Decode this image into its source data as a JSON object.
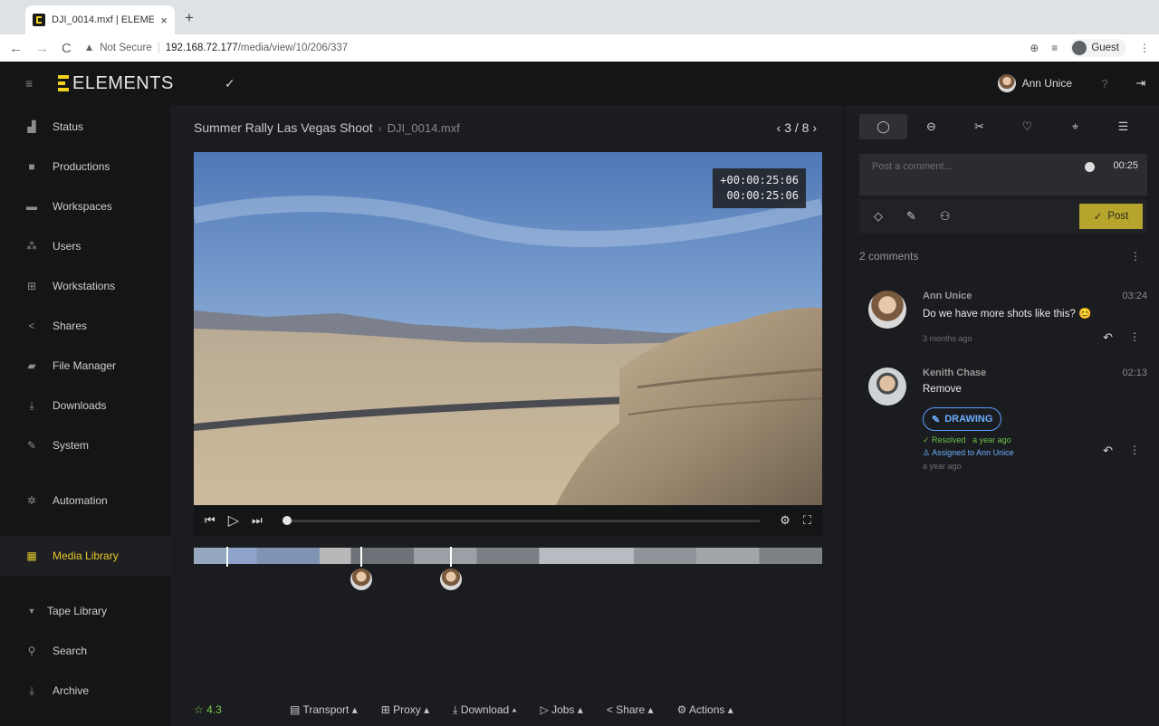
{
  "browser": {
    "tab_title": "DJI_0014.mxf | ELEMENTS",
    "url_security": "Not Secure",
    "url_host": "192.168.72.177",
    "url_path": "/media/view/10/206/337",
    "profile": "Guest"
  },
  "topbar": {
    "logo": "ELEMENTS",
    "user": "Ann Unice",
    "help": "?"
  },
  "sidebar": {
    "items": [
      {
        "label": "Status",
        "icon": "chart-icon"
      },
      {
        "label": "Productions",
        "icon": "briefcase-icon"
      },
      {
        "label": "Workspaces",
        "icon": "folder-icon"
      },
      {
        "label": "Users",
        "icon": "users-icon"
      },
      {
        "label": "Workstations",
        "icon": "network-icon"
      },
      {
        "label": "Shares",
        "icon": "share-icon"
      },
      {
        "label": "File Manager",
        "icon": "files-icon"
      },
      {
        "label": "Downloads",
        "icon": "download-icon"
      },
      {
        "label": "System",
        "icon": "wrench-icon"
      },
      {
        "label": "Automation",
        "icon": "cogs-icon"
      },
      {
        "label": "Media Library",
        "icon": "film-icon"
      },
      {
        "label": "Tape Library",
        "icon": "caret-down-icon"
      },
      {
        "label": "Search",
        "icon": "search-icon"
      },
      {
        "label": "Archive",
        "icon": "archive-icon"
      }
    ]
  },
  "main": {
    "project": "Summer Rally Las Vegas Shoot",
    "file": "DJI_0014.mxf",
    "pager": "3 / 8",
    "timecode_1": "+00:00:25:06",
    "timecode_2": "00:00:25:06",
    "progress": 0.0,
    "rating": "4.3",
    "actions": [
      "Transport",
      "Proxy",
      "Download",
      "Jobs",
      "Share",
      "Actions"
    ]
  },
  "panel": {
    "comment_placeholder": "Post a comment...",
    "comment_time": "00:25",
    "post_label": "Post",
    "count": "2 comments",
    "comments": [
      {
        "name": "Ann Unice",
        "time": "03:24",
        "text": "Do we have more shots like this? 😊",
        "ago": "3 months ago"
      },
      {
        "name": "Kenith Chase",
        "time": "02:13",
        "text": "Remove",
        "badge": "DRAWING",
        "resolved": "Resolved   a year ago",
        "assigned": "Assigned to Ann Unice",
        "ago": "a year ago"
      }
    ]
  },
  "colors": {
    "accent": "#e3c92a",
    "post_button": "#b6a42c",
    "link_blue": "#6aaeff",
    "rating_green": "#7bc54a"
  }
}
